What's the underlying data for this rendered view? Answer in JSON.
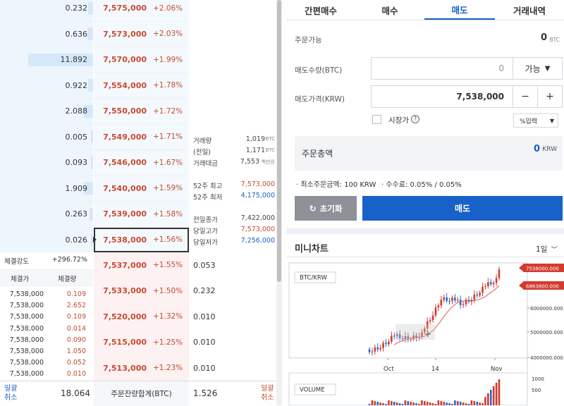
{
  "orderbook": {
    "asks": [
      {
        "qty": "0.232",
        "price": "7,575,000",
        "change": "+2.06%",
        "bar": 0.05
      },
      {
        "qty": "0.636",
        "price": "7,573,000",
        "change": "+2.03%",
        "bar": 0.06
      },
      {
        "qty": "11.892",
        "price": "7,570,000",
        "change": "+1.99%",
        "bar": 0.7
      },
      {
        "qty": "0.922",
        "price": "7,554,000",
        "change": "+1.78%",
        "bar": 0.05
      },
      {
        "qty": "2.088",
        "price": "7,550,000",
        "change": "+1.72%",
        "bar": 0.1
      },
      {
        "qty": "0.005",
        "price": "7,549,000",
        "change": "+1.71%",
        "bar": 0.01
      },
      {
        "qty": "0.093",
        "price": "7,546,000",
        "change": "+1.67%",
        "bar": 0.02
      },
      {
        "qty": "1.909",
        "price": "7,540,000",
        "change": "+1.59%",
        "bar": 0.1
      },
      {
        "qty": "0.263",
        "price": "7,539,000",
        "change": "+1.58%",
        "bar": 0.04
      },
      {
        "qty": "0.026",
        "price": "7,538,000",
        "change": "+1.56%",
        "bar": 0.01
      }
    ],
    "bids": [
      {
        "price": "7,537,000",
        "change": "+1.55%",
        "qty": "0.053"
      },
      {
        "price": "7,533,000",
        "change": "+1.50%",
        "qty": "0.232"
      },
      {
        "price": "7,520,000",
        "change": "+1.32%",
        "qty": "0.010"
      },
      {
        "price": "7,515,000",
        "change": "+1.25%",
        "qty": "0.010"
      },
      {
        "price": "7,513,000",
        "change": "+1.23%",
        "qty": "0.010"
      }
    ],
    "stats": {
      "volume_label": "거래량",
      "volume_value": "1,019",
      "volume_unit": "BTC",
      "prev_label": "(전일)",
      "prev_value": "1,171",
      "prev_unit": "BTC",
      "amount_label": "거래대금",
      "amount_value": "7,553",
      "amount_unit": "백만원",
      "high52_label": "52주 최고",
      "high52_value": "7,573,000",
      "low52_label": "52주 최저",
      "low52_value": "4,175,000",
      "prev_close_label": "전일종가",
      "prev_close_value": "7,422,000",
      "day_high_label": "당일고가",
      "day_high_value": "7,573,000",
      "day_low_label": "당일저가",
      "day_low_value": "7,256,000"
    },
    "strength_label": "체결강도",
    "strength_value": "+296.72%",
    "trades_header": {
      "price": "체결가",
      "volume": "체결량"
    },
    "trades": [
      {
        "price": "7,538,000",
        "volume": "0.109"
      },
      {
        "price": "7,538,000",
        "volume": "2.652"
      },
      {
        "price": "7,538,000",
        "volume": "0.109"
      },
      {
        "price": "7,538,000",
        "volume": "0.014"
      },
      {
        "price": "7,538,000",
        "volume": "0.090"
      },
      {
        "price": "7,538,000",
        "volume": "1.050"
      },
      {
        "price": "7,538,000",
        "volume": "0.052"
      },
      {
        "price": "7,538,000",
        "volume": "0.010"
      }
    ],
    "footer": {
      "cancel_all_left": "일괄\n취소",
      "ask_total": "18.064",
      "label": "주문잔량합계(BTC)",
      "bid_total": "1.526",
      "cancel_all_right": "일괄\n취소"
    }
  },
  "order_panel": {
    "tabs": [
      "간편매수",
      "매수",
      "매도",
      "거래내역"
    ],
    "active_tab": 2,
    "available_label": "주문가능",
    "available_value": "0",
    "available_unit": "BTC",
    "qty_label": "매도수량(BTC)",
    "qty_value": "0",
    "qty_button": "가능",
    "price_label": "매도가격(KRW)",
    "price_value": "7,538,000",
    "minus": "−",
    "plus": "+",
    "market_label": "시장가",
    "help": "?",
    "pct_input": "%입력",
    "total_label": "주문총액",
    "total_value": "0",
    "total_unit": "KRW",
    "min_order": "· 최소주문금액: 100 KRW",
    "fee": "· 수수료: 0.05% / 0.05%",
    "reset_label": "초기화",
    "sell_label": "매도"
  },
  "mini_chart": {
    "title": "미니차트",
    "period": "1일",
    "symbol": "BTC/KRW",
    "price_tag_1": "7538000.000",
    "price_tag_2": "6863800.000",
    "y_ticks": [
      "6000000.000",
      "5000000.000",
      "4000000.000"
    ],
    "x_ticks": [
      "Oct",
      "14",
      "Nov"
    ],
    "volume_label": "VOLUME",
    "vol_ticks": [
      "1000",
      "500"
    ],
    "colors": {
      "up": "#d23b2f",
      "down": "#1f6bd6",
      "ma": "#e1584a"
    }
  }
}
